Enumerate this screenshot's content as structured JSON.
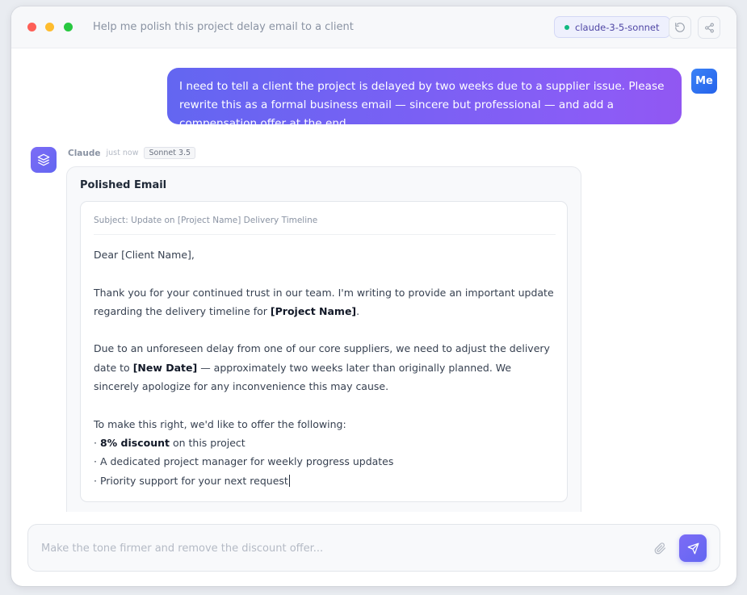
{
  "window": {
    "title": "Help me polish this project delay email to a client",
    "model": "claude-3-5-sonnet",
    "icons": [
      "refresh-icon",
      "share-icon"
    ]
  },
  "user": {
    "avatar": "Me",
    "message": "I need to tell a client the project is delayed by two weeks due to a supplier issue. Please rewrite this as a formal business email — sincere but professional — and add a compensation offer at the end."
  },
  "assistant": {
    "name": "Claude",
    "time": "just now",
    "model_tag": "Sonnet 3.5",
    "card_title": "Polished Email",
    "email": {
      "subject": "Subject: Update on [Project Name] Delivery Timeline",
      "greeting": "Dear [Client Name],",
      "p1_before": "Thank you for your continued trust in our team. I'm writing to provide an important update regarding the delivery timeline for ",
      "p1_bold": "[Project Name]",
      "p1_after": ".",
      "p2_before": "Due to an unforeseen delay from one of our core suppliers, we need to adjust the delivery date to ",
      "p2_bold": "[New Date]",
      "p2_after": " — approximately two weeks later than originally planned. We sincerely apologize for any inconvenience this may cause.",
      "p3_intro": "To make this right, we'd like to offer the following:",
      "bullet1_prefix": "· ",
      "bullet1_bold": "8% discount",
      "bullet1_after": " on this project",
      "bullet2": "· A dedicated project manager for weekly progress updates",
      "bullet3": "· Priority support for your next request"
    }
  },
  "composer": {
    "placeholder": "Make the tone firmer and remove the discount offer...",
    "value": ""
  },
  "colors": {
    "accent": "#6366f1",
    "user_bubble_end": "#8b5cf6",
    "status_dot": "#10b981"
  }
}
